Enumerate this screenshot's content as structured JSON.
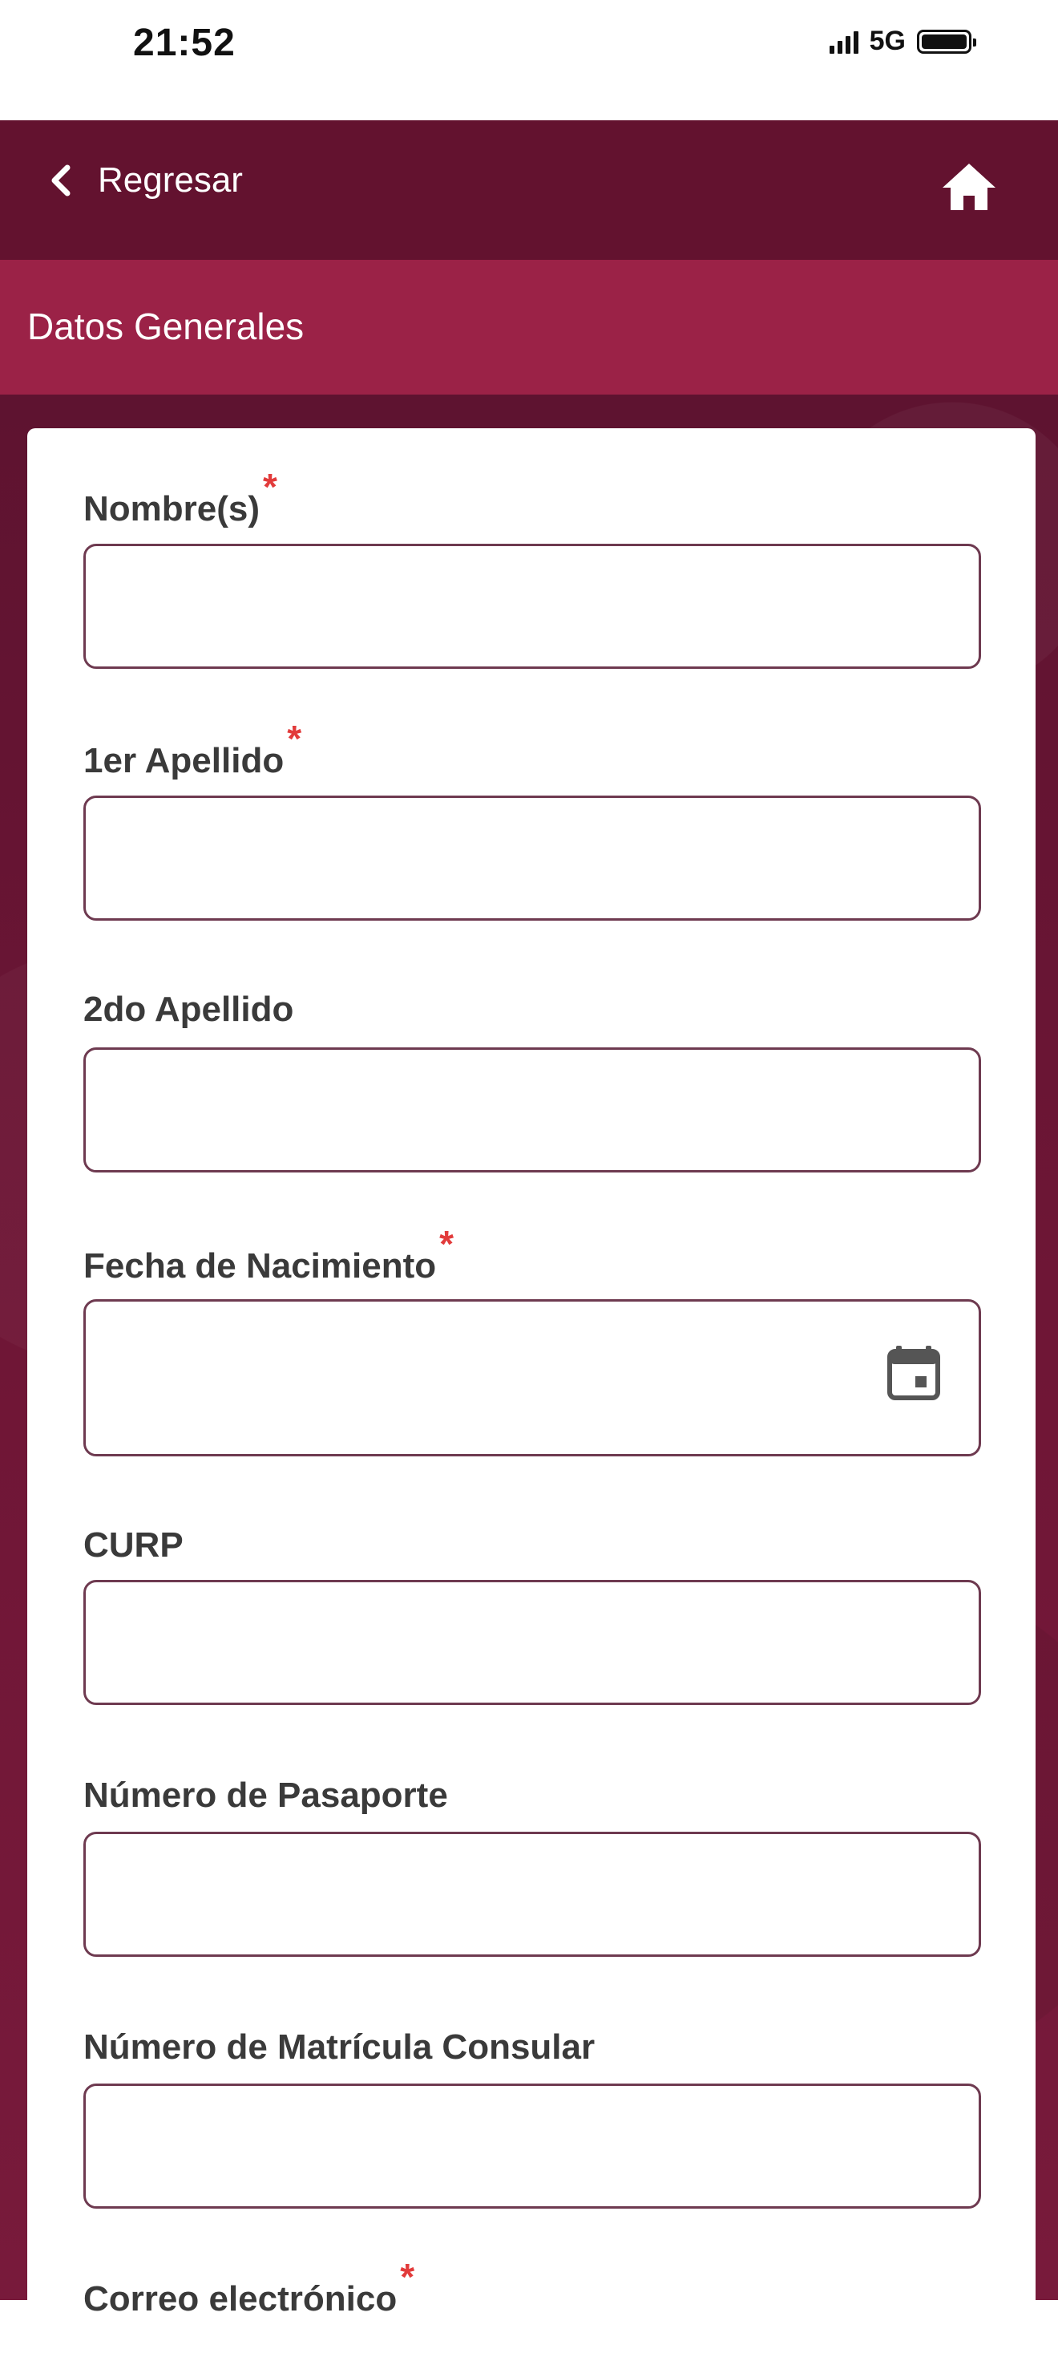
{
  "status_bar": {
    "time": "21:52",
    "network": "5G",
    "icons": [
      "signal-icon",
      "battery-icon"
    ]
  },
  "nav": {
    "back_label": "Regresar",
    "icons": [
      "chevron-left-icon",
      "home-icon"
    ]
  },
  "section": {
    "title": "Datos Generales"
  },
  "colors": {
    "nav_bg": "#63122f",
    "section_bg": "#9b2247",
    "required": "#e23b3b",
    "input_border": "#6e3a50"
  },
  "form": {
    "fields": [
      {
        "label": "Nombre(s)",
        "required": true,
        "value": ""
      },
      {
        "label": "1er Apellido",
        "required": true,
        "value": ""
      },
      {
        "label": "2do Apellido",
        "required": false,
        "value": ""
      },
      {
        "label": "Fecha de Nacimiento",
        "required": true,
        "value": "",
        "icon": "calendar-icon"
      },
      {
        "label": "CURP",
        "required": false,
        "value": ""
      },
      {
        "label": "Número de Pasaporte",
        "required": false,
        "value": ""
      },
      {
        "label": "Número de Matrícula Consular",
        "required": false,
        "value": ""
      },
      {
        "label": "Correo electrónico",
        "required": true,
        "value": ""
      }
    ],
    "required_mark": "*"
  }
}
